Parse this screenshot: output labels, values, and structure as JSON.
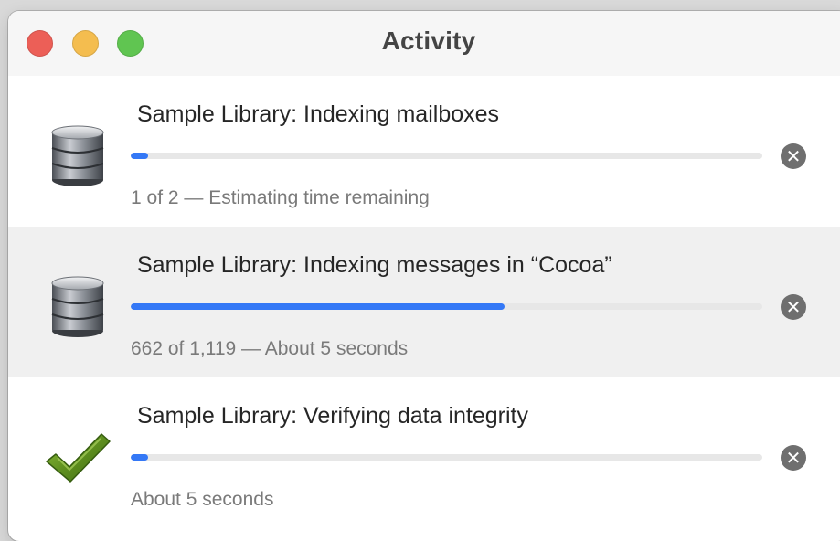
{
  "window": {
    "title": "Activity",
    "traffic_lights": [
      {
        "name": "close",
        "color": "#ec5f57"
      },
      {
        "name": "minimize",
        "color": "#f4bd4f"
      },
      {
        "name": "zoom",
        "color": "#60c551"
      }
    ]
  },
  "colors": {
    "progress_fill": "#3478f6",
    "progress_track": "#e7e7e7",
    "alt_row_bg": "#f0f0f0"
  },
  "tasks": [
    {
      "icon": "database-icon",
      "title": "Sample Library: Indexing mailboxes",
      "progress": 0.027,
      "status": "1 of 2 — Estimating time remaining",
      "stop_glyph": "✕"
    },
    {
      "icon": "database-icon",
      "title": "Sample Library: Indexing messages in “Cocoa”",
      "progress": 0.592,
      "status": "662 of 1,119 — About 5 seconds",
      "stop_glyph": "✕"
    },
    {
      "icon": "checkmark-icon",
      "title": "Sample Library: Verifying data integrity",
      "progress": 0.027,
      "status": "About 5 seconds",
      "stop_glyph": "✕"
    }
  ]
}
